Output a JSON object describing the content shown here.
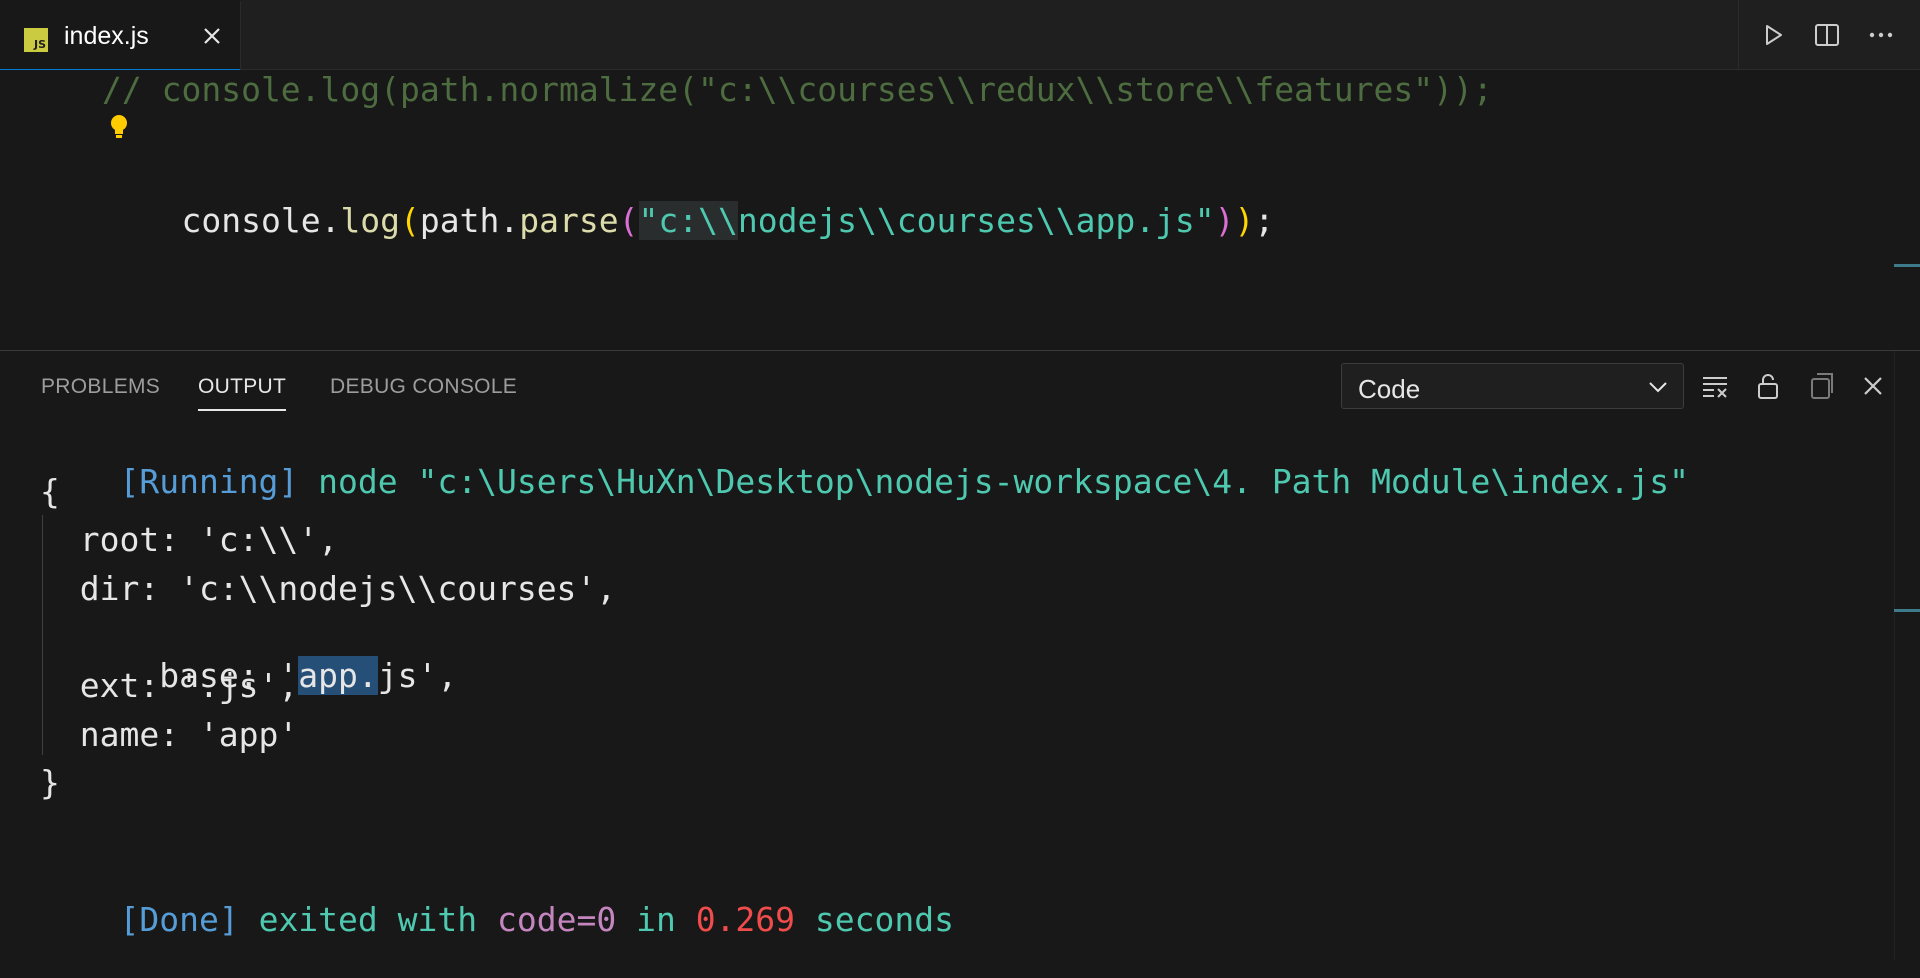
{
  "tab": {
    "icon_text": "JS",
    "label": "index.js"
  },
  "editor": {
    "comment_line": "// console.log(path.normalize(\"c:\\\\courses\\\\redux\\\\store\\\\features\"));",
    "code": {
      "obj": "console",
      "dot1": ".",
      "method": "log",
      "open1": "(",
      "arg_obj": "path",
      "dot2": ".",
      "arg_method": "parse",
      "open2": "(",
      "string_hl": "\"c:\\\\",
      "string_rest": "nodejs\\\\courses\\\\app.js\"",
      "close2": ")",
      "close1": ")",
      "semi": ";"
    }
  },
  "panel": {
    "tabs": [
      "PROBLEMS",
      "OUTPUT",
      "DEBUG CONSOLE"
    ],
    "active_tab": "OUTPUT",
    "channel": "Code"
  },
  "output": {
    "running_tag": "[Running]",
    "running_cmd": " node \"c:\\Users\\HuXn\\Desktop\\nodejs-workspace\\4. Path Module\\index.js\"",
    "open_brace": "{",
    "root": "  root: 'c:\\\\',",
    "dir": "  dir: 'c:\\\\nodejs\\\\courses',",
    "base_pre": "  base: '",
    "base_sel": "app.",
    "base_post": "js',",
    "ext": "  ext: '.js',",
    "name": "  name: 'app'",
    "close_brace": "}",
    "done_tag": "[Done]",
    "done_text1": " exited with ",
    "done_code": "code=0",
    "done_text2": " in ",
    "done_time": "0.269",
    "done_text3": " seconds"
  },
  "colors": {
    "accent": "#0078d4",
    "string": "#4ec9b0",
    "function": "#dcdcaa",
    "bracket1": "#ffd700",
    "bracket2": "#da70d6",
    "output_tag": "#569cd6",
    "code_value": "#c586c0",
    "time_value": "#f14c4c"
  }
}
